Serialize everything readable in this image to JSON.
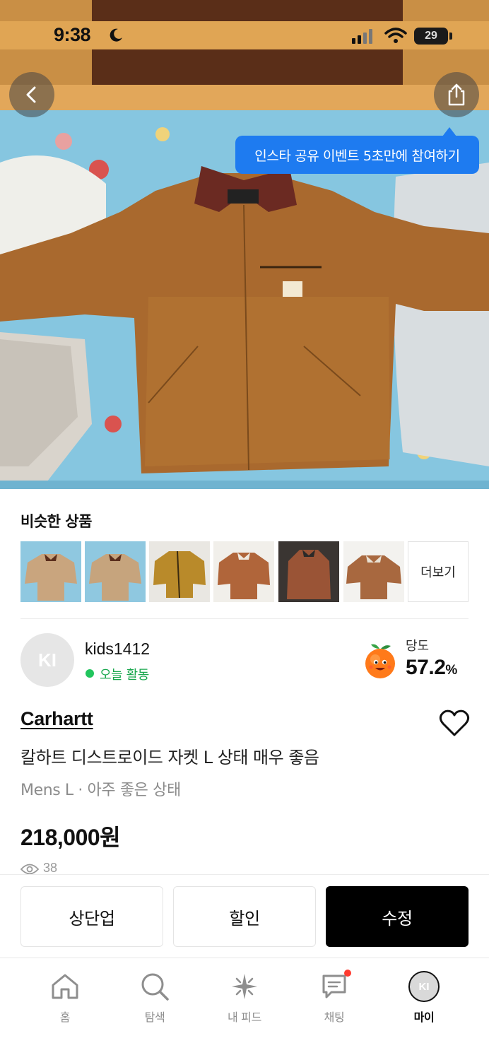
{
  "status_bar": {
    "time": "9:38",
    "battery": "29"
  },
  "header": {
    "tooltip": "인스타 공유 이벤트 5초만에 참여하기"
  },
  "similar": {
    "title": "비슷한 상품",
    "more_label": "더보기",
    "thumb_colors": [
      "#c9a57e",
      "#c6a47d",
      "#b98a2a",
      "#b0653a",
      "#9a5436",
      "#a8683f"
    ]
  },
  "seller": {
    "avatar_initials": "KI",
    "name": "kids1412",
    "activity": "오늘 활동",
    "temp_label": "당도",
    "temp_value": "57.2",
    "temp_unit": "%"
  },
  "product": {
    "brand": "Carhartt",
    "title": "칼하트 디스트로이드 자켓 L 상태 매우 좋음",
    "meta": "Mens L · 아주 좋은 상태",
    "price": "218,000원",
    "views": "38"
  },
  "actions": {
    "bump": "상단업",
    "discount": "할인",
    "edit": "수정"
  },
  "tabbar": {
    "home": "홈",
    "explore": "탐색",
    "feed": "내 피드",
    "chat": "채팅",
    "my": "마이",
    "my_initials": "KI"
  },
  "colors": {
    "tooltip_bg": "#1e7bf0",
    "active_green": "#21c55d",
    "primary_button": "#000000",
    "chat_badge": "#ff3b30"
  }
}
